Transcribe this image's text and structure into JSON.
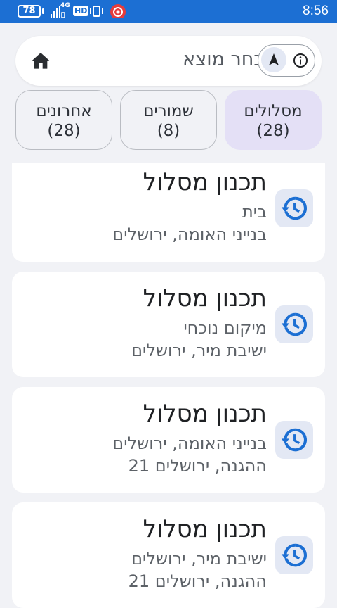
{
  "status_bar": {
    "battery": "78",
    "network": "4G",
    "hd": "HD",
    "time": "8:56"
  },
  "search": {
    "placeholder": "בחר מוצא",
    "icons": {
      "home": "home-icon",
      "navigate": "navigation-arrow-icon",
      "info": "info-icon"
    }
  },
  "tabs": [
    {
      "label": "מסלולים",
      "count": "(28)",
      "active": true
    },
    {
      "label": "שמורים",
      "count": "(8)",
      "active": false
    },
    {
      "label": "אחרונים",
      "count": "(28)",
      "active": false
    }
  ],
  "routes": [
    {
      "title": "תכנון מסלול",
      "from": "בית",
      "to": "בנייני האומה, ירושלים",
      "icon": "history-icon"
    },
    {
      "title": "תכנון מסלול",
      "from": "מיקום נוכחי",
      "to": "ישיבת מיר, ירושלים",
      "icon": "history-icon"
    },
    {
      "title": "תכנון מסלול",
      "from": "בנייני האומה, ירושלים",
      "to": "ההגנה, ירושלים 21",
      "icon": "history-icon"
    },
    {
      "title": "תכנון מסלול",
      "from": "ישיבת מיר, ירושלים",
      "to": "ההגנה, ירושלים 21",
      "icon": "history-icon"
    }
  ],
  "colors": {
    "status_bar": "#1c6fd3",
    "accent_tab": "#e4e0f6",
    "icon_blue": "#1c6fd3",
    "background": "#f1f2f6"
  }
}
